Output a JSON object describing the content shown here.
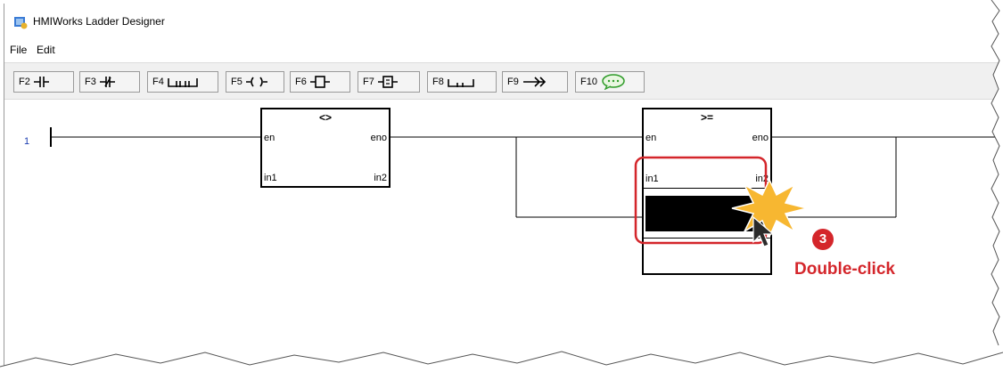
{
  "window": {
    "title": "HMIWorks Ladder Designer"
  },
  "menu": {
    "items": [
      "File",
      "Edit"
    ]
  },
  "toolbar": {
    "buttons": [
      {
        "key": "F2",
        "icon": "normally-open-contact-icon"
      },
      {
        "key": "F3",
        "icon": "normally-closed-contact-icon"
      },
      {
        "key": "F4",
        "icon": "parallel-contact-icon"
      },
      {
        "key": "F5",
        "icon": "output-coil-icon"
      },
      {
        "key": "F6",
        "icon": "function-block-icon"
      },
      {
        "key": "F7",
        "icon": "function-block-alt-icon"
      },
      {
        "key": "F8",
        "icon": "branch-icon"
      },
      {
        "key": "F9",
        "icon": "jump-arrow-icon"
      },
      {
        "key": "F10",
        "icon": "comment-bubble-icon"
      }
    ]
  },
  "ladder": {
    "rung_number": "1",
    "block1": {
      "op": "<>",
      "en": "en",
      "eno": "eno",
      "in1": "in1",
      "in2": "in2"
    },
    "block2": {
      "op": ">=",
      "en": "en",
      "eno": "eno",
      "in1": "in1",
      "in2": "in2"
    }
  },
  "annotation": {
    "step": "3",
    "label": "Double-click",
    "color": "#d4262b"
  }
}
